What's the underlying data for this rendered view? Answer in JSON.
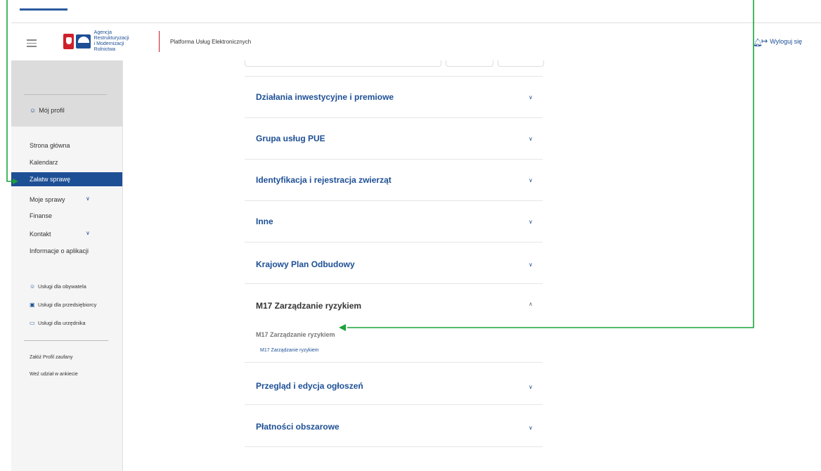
{
  "header": {
    "logo_line1": "Agencja Restrukturyzacji",
    "logo_line2": "i Modernizacji Rolnictwa",
    "platform_title": "Platforma Usług Elektronicznych",
    "logout_label": "Wyloguj się"
  },
  "sidebar": {
    "profile_label": "Mój profil",
    "nav": [
      {
        "label": "Strona główna"
      },
      {
        "label": "Kalendarz"
      },
      {
        "label": "Załatw sprawę"
      },
      {
        "label": "Moje sprawy"
      },
      {
        "label": "Finanse"
      },
      {
        "label": "Kontakt"
      },
      {
        "label": "Informacje o aplikacji"
      }
    ],
    "services": [
      {
        "label": "Usługi dla obywatela"
      },
      {
        "label": "Usługi dla przedsiębiorcy"
      },
      {
        "label": "Usługi dla urzędnika"
      }
    ],
    "footer_links": [
      {
        "label": "Załóż Profil zaufany"
      },
      {
        "label": "Weź udział w ankiecie"
      }
    ]
  },
  "accordion": [
    {
      "title": "Działania inwestycyjne i premiowe"
    },
    {
      "title": "Grupa usług PUE"
    },
    {
      "title": "Identyfikacja i rejestracja zwierząt"
    },
    {
      "title": "Inne"
    },
    {
      "title": "Krajowy Plan Odbudowy"
    },
    {
      "title": "M17 Zarządzanie ryzykiem",
      "expanded": true,
      "subheading": "M17 Zarządzanie ryzykiem",
      "link": "M17 Zarządzanie ryzykiem"
    },
    {
      "title": "Przegląd i edycja ogłoszeń"
    },
    {
      "title": "Płatności obszarowe"
    }
  ],
  "colors": {
    "brand": "#1d4f95",
    "annotation_arrow": "#1aa33a",
    "emblem": "#d0202a"
  },
  "icons": {
    "menu": "hamburger-icon",
    "notifications": "bell-icon",
    "logout": "logout-icon",
    "profile": "user-icon",
    "expand": "chevron-down-icon",
    "collapse": "chevron-up-icon"
  }
}
